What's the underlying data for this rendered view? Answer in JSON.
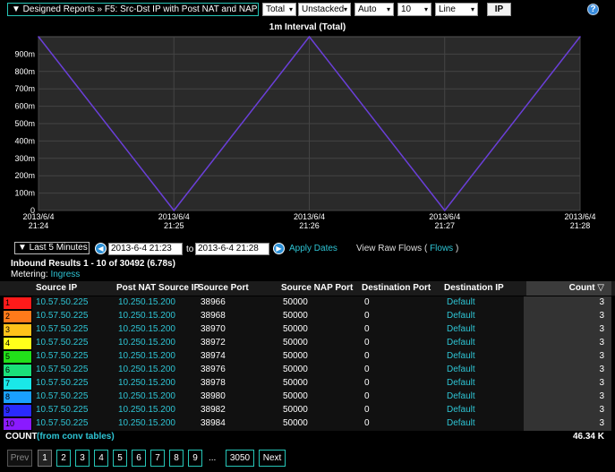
{
  "header": {
    "report_title": "▼ Designed Reports » F5: Src-Dst IP with Post NAT and NAP",
    "selects": [
      "Total",
      "Unstacked",
      "Auto",
      "10",
      "Line"
    ],
    "ip_button": "IP",
    "help_label": "?"
  },
  "chart_data": {
    "type": "line",
    "title": "1m Interval (Total)",
    "y_ticks": [
      "0",
      "100m",
      "200m",
      "300m",
      "400m",
      "500m",
      "600m",
      "700m",
      "800m",
      "900m"
    ],
    "x_ticks": [
      {
        "date": "2013/6/4",
        "time": "21:24"
      },
      {
        "date": "2013/6/4",
        "time": "21:25"
      },
      {
        "date": "2013/6/4",
        "time": "21:26"
      },
      {
        "date": "2013/6/4",
        "time": "21:27"
      },
      {
        "date": "2013/6/4",
        "time": "21:28"
      }
    ],
    "x": [
      "21:24",
      "21:25",
      "21:26",
      "21:27",
      "21:28"
    ],
    "values": [
      1.0,
      0,
      1.0,
      0,
      1.0
    ],
    "ylim": [
      0,
      1.0
    ],
    "grid": true,
    "line_color": "#6a3fd8"
  },
  "controls": {
    "range_label": "▼ Last 5 Minutes",
    "from_date": "2013-6-4 21:23",
    "to_label": "to",
    "to_date": "2013-6-4 21:28",
    "apply_label": "Apply Dates",
    "raw_flows_prefix": "View Raw Flows (",
    "raw_flows_link": "Flows",
    "raw_flows_suffix": ")"
  },
  "results": {
    "summary": "Inbound Results 1 - 10 of 30492 (6.78s)",
    "metering_label": "Metering:",
    "metering_value": "Ingress"
  },
  "table": {
    "columns": [
      "Source IP",
      "Post NAT Source IP",
      "Source Port",
      "Source NAP Port",
      "Destination Port",
      "Destination IP",
      "Count ▽"
    ],
    "rows": [
      {
        "n": "1",
        "color": "#ff1a1a",
        "src": "10.57.50.225",
        "nat": "10.250.15.200",
        "sport": "38966",
        "nap": "50000",
        "dport": "0",
        "dst": "Default",
        "count": "3"
      },
      {
        "n": "2",
        "color": "#ff7a1a",
        "src": "10.57.50.225",
        "nat": "10.250.15.200",
        "sport": "38968",
        "nap": "50000",
        "dport": "0",
        "dst": "Default",
        "count": "3"
      },
      {
        "n": "3",
        "color": "#ffc21a",
        "src": "10.57.50.225",
        "nat": "10.250.15.200",
        "sport": "38970",
        "nap": "50000",
        "dport": "0",
        "dst": "Default",
        "count": "3"
      },
      {
        "n": "4",
        "color": "#ffff1a",
        "src": "10.57.50.225",
        "nat": "10.250.15.200",
        "sport": "38972",
        "nap": "50000",
        "dport": "0",
        "dst": "Default",
        "count": "3"
      },
      {
        "n": "5",
        "color": "#22e01a",
        "src": "10.57.50.225",
        "nat": "10.250.15.200",
        "sport": "38974",
        "nap": "50000",
        "dport": "0",
        "dst": "Default",
        "count": "3"
      },
      {
        "n": "6",
        "color": "#1ae07a",
        "src": "10.57.50.225",
        "nat": "10.250.15.200",
        "sport": "38976",
        "nap": "50000",
        "dport": "0",
        "dst": "Default",
        "count": "3"
      },
      {
        "n": "7",
        "color": "#1ae8e8",
        "src": "10.57.50.225",
        "nat": "10.250.15.200",
        "sport": "38978",
        "nap": "50000",
        "dport": "0",
        "dst": "Default",
        "count": "3"
      },
      {
        "n": "8",
        "color": "#1aa0ff",
        "src": "10.57.50.225",
        "nat": "10.250.15.200",
        "sport": "38980",
        "nap": "50000",
        "dport": "0",
        "dst": "Default",
        "count": "3"
      },
      {
        "n": "9",
        "color": "#2a2aff",
        "src": "10.57.50.225",
        "nat": "10.250.15.200",
        "sport": "38982",
        "nap": "50000",
        "dport": "0",
        "dst": "Default",
        "count": "3"
      },
      {
        "n": "10",
        "color": "#8a1aff",
        "src": "10.57.50.225",
        "nat": "10.250.15.200",
        "sport": "38984",
        "nap": "50000",
        "dport": "0",
        "dst": "Default",
        "count": "3"
      }
    ],
    "count_label": "COUNT",
    "count_source": "(from conv tables)",
    "count_total": "46.34 K"
  },
  "pagination": {
    "prev": "Prev",
    "pages": [
      "1",
      "2",
      "3",
      "4",
      "5",
      "6",
      "7",
      "8",
      "9"
    ],
    "ellipsis": "...",
    "last": "3050",
    "next": "Next"
  }
}
